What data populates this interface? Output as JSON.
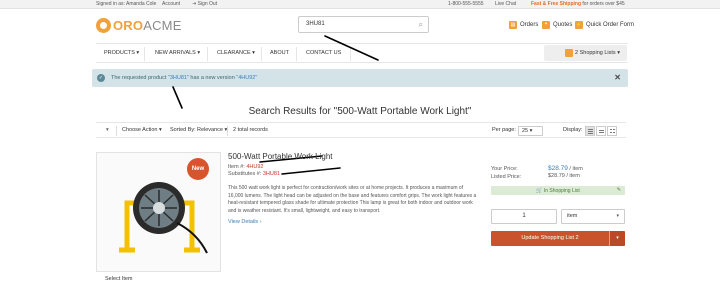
{
  "topbar": {
    "signed_in": "Signed in as: Amanda Cole",
    "account": "Account",
    "sign_out": "Sign Out",
    "phone": "1-800-555-5555",
    "live_chat": "Live Chat",
    "shipping_bold": "Fast & Free Shipping",
    "shipping_rest": " for orders over $45"
  },
  "header": {
    "logo_oro": "ORO",
    "logo_acme": "ACME",
    "search_value": "3HU81",
    "orders": "Orders",
    "quotes": "Quotes",
    "quick_order": "Quick Order Form"
  },
  "nav": {
    "items": [
      "PRODUCTS ▾",
      "NEW ARRIVALS ▾",
      "CLEARANCE ▾",
      "ABOUT",
      "CONTACT US"
    ],
    "shopping_lists": "2 Shopping Lists ▾"
  },
  "notice": {
    "prefix": "The requested product ",
    "old_sku": "\"3HU81\"",
    "middle": " has a new version ",
    "new_sku": "\"4HU92\""
  },
  "results": {
    "title": "Search Results for \"500-Watt Portable Work Light\"",
    "choose_action": "Choose Action ▾",
    "sorted_by_label": "Sorted By:",
    "sorted_by_value": "Relevance ▾",
    "total": "2 total records",
    "per_page_label": "Per page:",
    "per_page_value": "25 ▾",
    "display_label": "Display:"
  },
  "product": {
    "badge": "New",
    "title": "500-Watt Portable Work Light",
    "item_label": "Item #: ",
    "item_value": "4HU92",
    "subs_label": "Substitutes #: ",
    "subs_value": "3HU81",
    "description": "This 500 watt work light is perfect for contruction/work sites or at home projects. It produces a maximum of 16,000 lumens. The light head can be adjusted on the base and features comfort grips. The work light features a heat-resistant tempered glass shade for ultimate protection This lamp is great for both indoor and outdoor work and is weather resistant. It's small, lightweight, and easy to transport.",
    "view_details": "View Details ›",
    "select_item": "Select Item",
    "your_price_label": "Your Price:",
    "your_price_value": "$28.79",
    "your_price_unit": " / item",
    "listed_price_label": "Listed Price:",
    "listed_price_value": "$28.79 / item",
    "in_list": "In Shopping List",
    "qty": "1",
    "unit": "item",
    "update_button": "Update Shopping List 2"
  },
  "icons": {
    "search": "search-icon",
    "orders": "orders-icon",
    "quotes": "quotes-icon",
    "quick_order": "quick-order-icon",
    "close": "close-icon"
  },
  "colors": {
    "brand": "#f0a13b",
    "accent_button": "#c9542b",
    "notice_bg": "#d4e3e7",
    "link": "#3a7fb5"
  }
}
